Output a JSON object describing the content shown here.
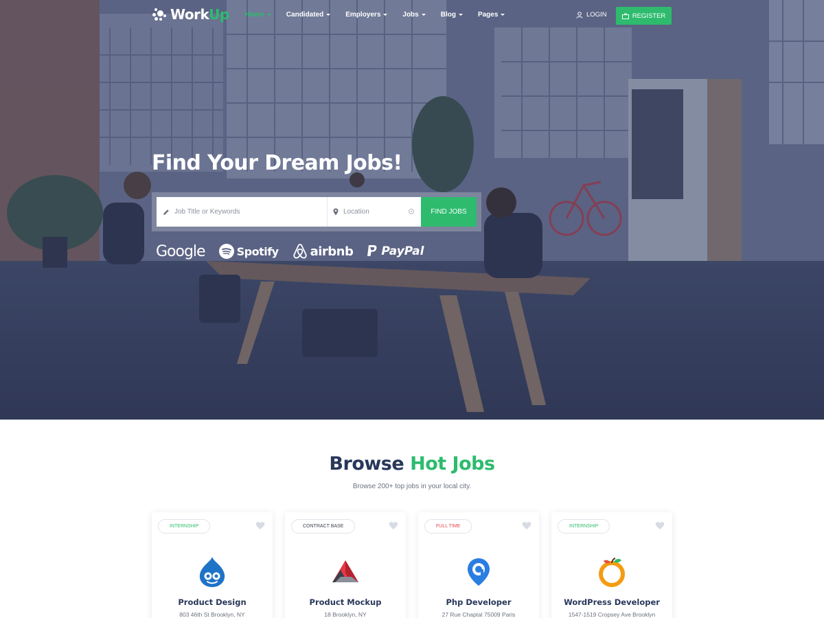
{
  "colors": {
    "accent": "#2ebb6e",
    "navy": "#28375a",
    "hero_overlay": "#30395c",
    "full_time": "#e8434b"
  },
  "brand": {
    "work": "Work",
    "up": "Up"
  },
  "nav": {
    "items": [
      {
        "label": "Home",
        "active": true
      },
      {
        "label": "Candidated",
        "active": false
      },
      {
        "label": "Employers",
        "active": false
      },
      {
        "label": "Jobs",
        "active": false
      },
      {
        "label": "Blog",
        "active": false
      },
      {
        "label": "Pages",
        "active": false
      }
    ],
    "login_label": "LOGIN",
    "register_label": "REGISTER"
  },
  "hero": {
    "title": "Find Your Dream Jobs!",
    "search": {
      "keyword_placeholder": "Job Title or Keywords",
      "location_placeholder": "Location",
      "button_label": "FIND JOBS"
    },
    "brands": [
      "Google",
      "Spotify",
      "airbnb",
      "PayPal"
    ]
  },
  "browse": {
    "title_part1": "Browse",
    "title_part2": "Hot Jobs",
    "subtitle": "Browse 200+ top jobs in your local city."
  },
  "jobs": [
    {
      "badge": "INTERNSHIP",
      "badge_color": "#2ebb6e",
      "title": "Product Design",
      "address": "803 46th St Brooklyn, NY",
      "logo": "drupal-icon"
    },
    {
      "badge": "CONTRACT BASE",
      "badge_color": "#3a3f4b",
      "title": "Product Mockup",
      "address": "18 Brooklyn, NY",
      "logo": "triangle-icon"
    },
    {
      "badge": "FULL TIME",
      "badge_color": "#e8434b",
      "title": "Php Developer",
      "address": "27 Rue Chaptal 75009 Paris",
      "logo": "location-pin-icon"
    },
    {
      "badge": "INTERNSHIP",
      "badge_color": "#2ebb6e",
      "title": "WordPress Developer",
      "address": "1547-1519 Cropsey Ave Brooklyn",
      "logo": "orange-icon"
    }
  ]
}
